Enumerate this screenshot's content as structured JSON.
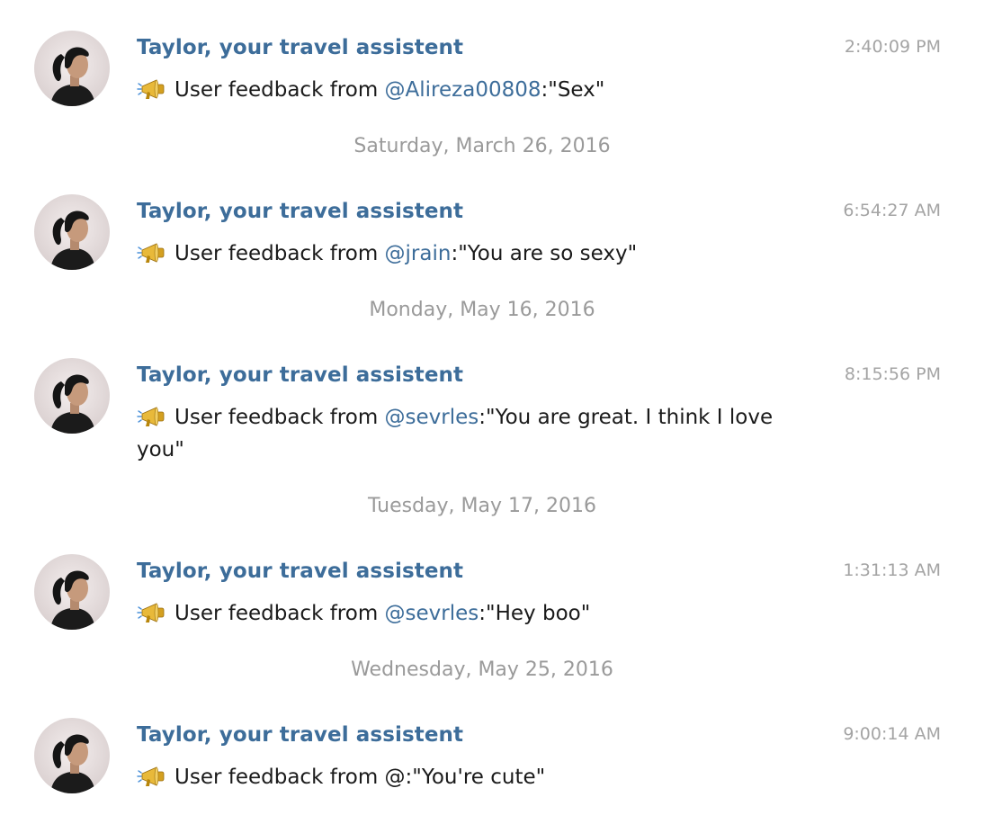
{
  "messages": [
    {
      "sender": "Taylor, your travel assistent",
      "time": "2:40:09 PM",
      "prefix": "User feedback from ",
      "mention": "@Alireza00808",
      "suffix": ":\"Sex\""
    },
    {
      "sender": "Taylor, your travel assistent",
      "time": "6:54:27 AM",
      "prefix": "User feedback from ",
      "mention": "@jrain",
      "suffix": ":\"You are so sexy\""
    },
    {
      "sender": "Taylor, your travel assistent",
      "time": "8:15:56 PM",
      "prefix": "User feedback from ",
      "mention": "@sevrles",
      "suffix": ":\"You are great. I think I love you\""
    },
    {
      "sender": "Taylor, your travel assistent",
      "time": "1:31:13 AM",
      "prefix": "User feedback from ",
      "mention": "@sevrles",
      "suffix": ":\"Hey boo\""
    },
    {
      "sender": "Taylor, your travel assistent",
      "time": "9:00:14 AM",
      "prefix": "User feedback from @:\"You're cute\"",
      "mention": "",
      "suffix": ""
    }
  ],
  "date_separators": [
    "Saturday, March 26, 2016",
    "Monday, May 16, 2016",
    "Tuesday, May 17, 2016",
    "Wednesday, May 25, 2016"
  ],
  "icons": {
    "avatar": "avatar-photo-icon",
    "megaphone": "megaphone-icon"
  }
}
